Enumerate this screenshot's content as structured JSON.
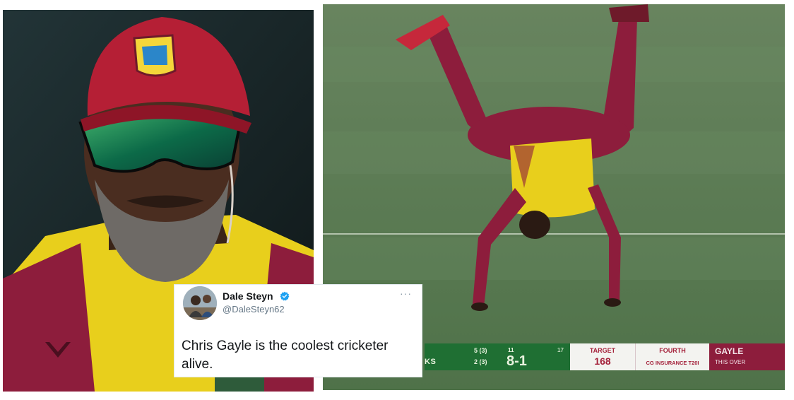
{
  "scoreboard": {
    "team_partial": "KS",
    "stat_top": "5 (3)",
    "stat_bottom": "2 (3)",
    "stat_num": "11",
    "stat_num2": "17",
    "figures": "8-1",
    "target_label": "TARGET",
    "target_value": "168",
    "match_label": "FOURTH",
    "competition": "CG INSURANCE T20I",
    "player": "GAYLE",
    "player_sub": "THIS OVER"
  },
  "tweet": {
    "display_name": "Dale Steyn",
    "handle": "@DaleSteyn62",
    "more": "···",
    "text": "Chris Gayle is the coolest cricketer alive."
  },
  "icons": {
    "verified": "verified-badge-icon",
    "more": "more-options-icon"
  },
  "colors": {
    "cap_red": "#b51f35",
    "jersey_yellow": "#ecd21a",
    "jersey_maroon": "#8d1d3c",
    "pitch_green": "#5e7f57",
    "scorebar_green": "#1f6f33",
    "verified_blue": "#1da1f2"
  }
}
